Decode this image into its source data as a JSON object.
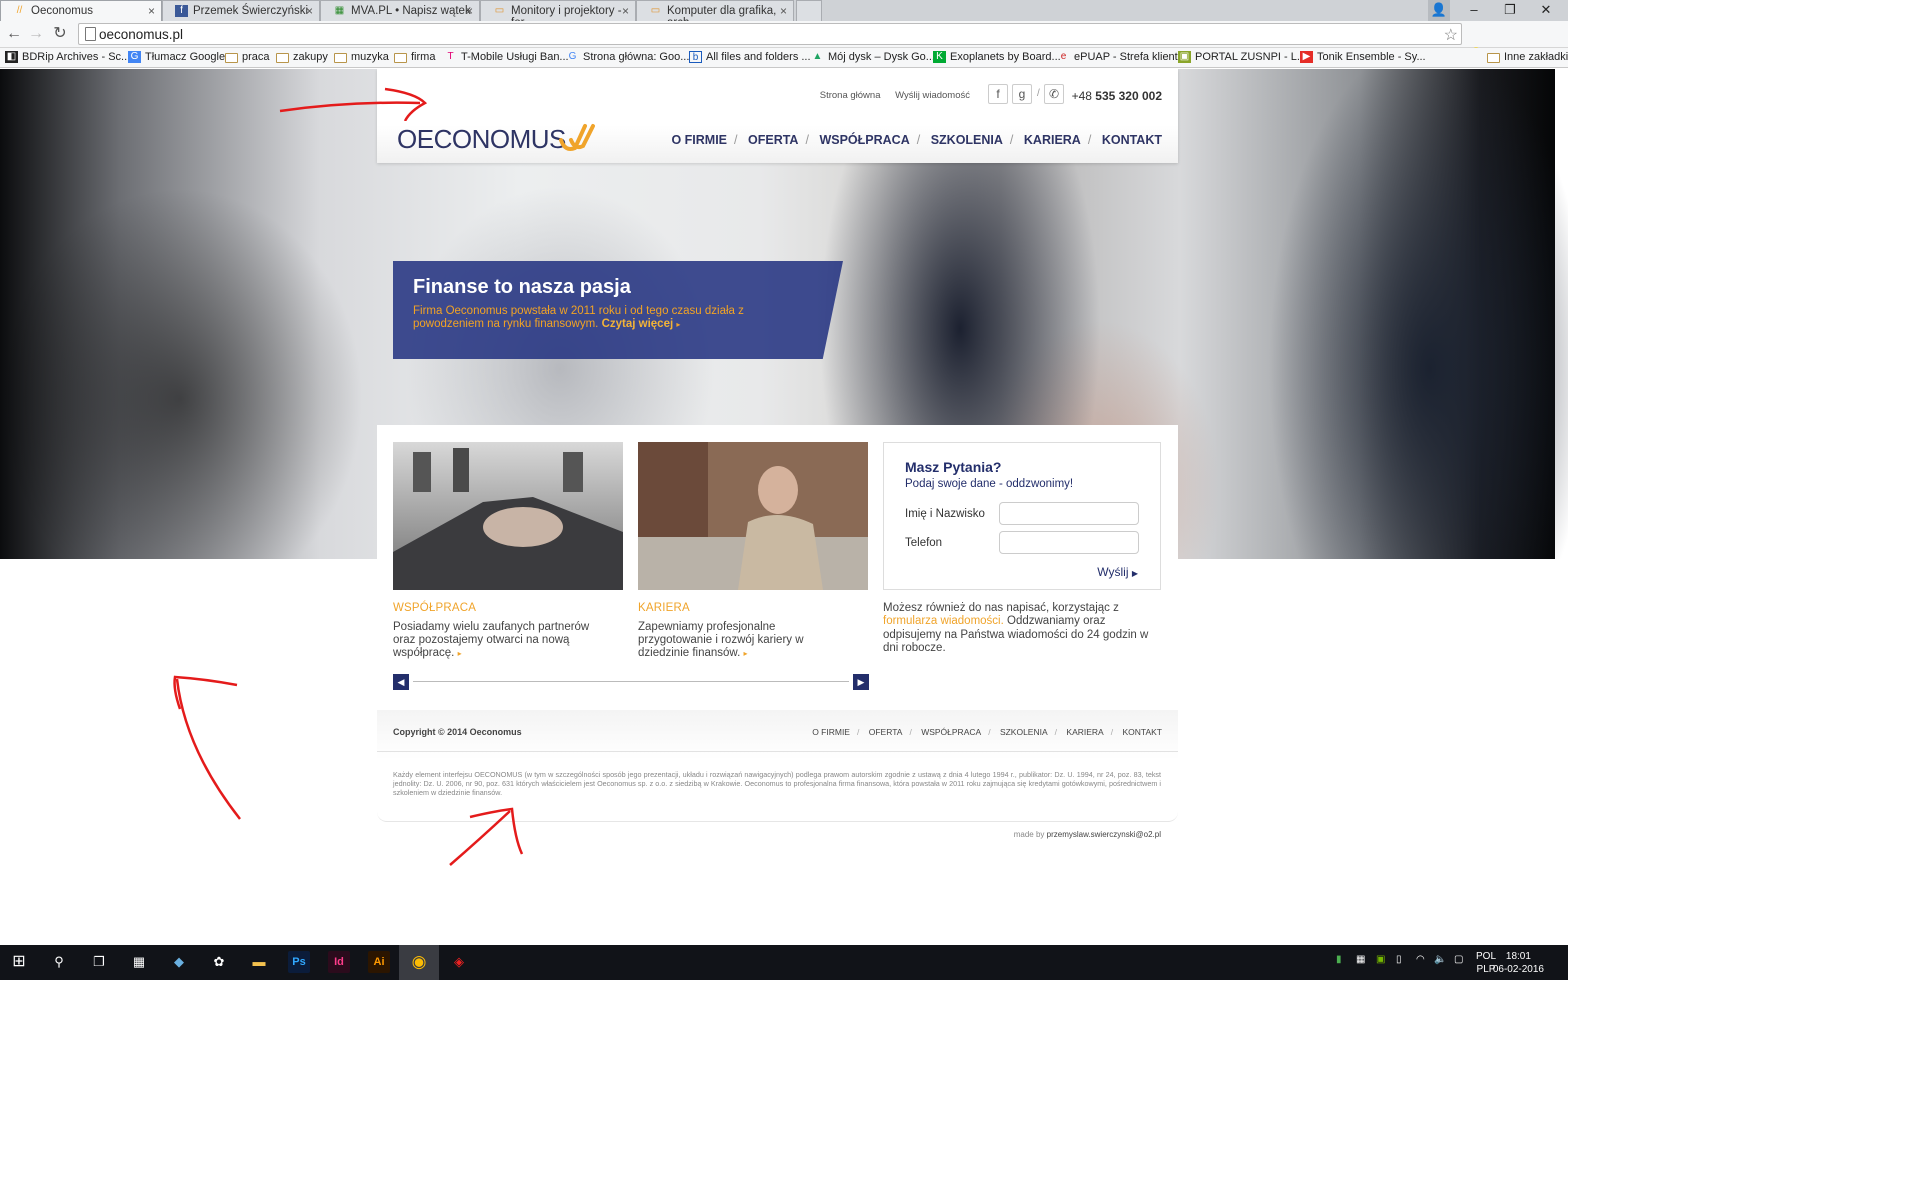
{
  "browser": {
    "tabs": [
      {
        "label": "Oeconomus",
        "active": true,
        "icon": "oeconomus-favicon"
      },
      {
        "label": "Przemek Świerczyński",
        "icon": "facebook-icon"
      },
      {
        "label": "MVA.PL • Napisz wątek",
        "icon": "mva-icon"
      },
      {
        "label": "Monitory i projektory - for",
        "icon": "folder-icon"
      },
      {
        "label": "Komputer dla grafika, arch",
        "icon": "folder-icon"
      }
    ],
    "url": "oeconomus.pl",
    "bookmarks": [
      {
        "label": "BDRip Archives - Sc...",
        "icon": "bdrip-icon"
      },
      {
        "label": "Tłumacz Google",
        "icon": "translate-icon"
      },
      {
        "label": "praca",
        "icon": "folder-icon"
      },
      {
        "label": "zakupy",
        "icon": "folder-icon"
      },
      {
        "label": "muzyka",
        "icon": "folder-icon"
      },
      {
        "label": "firma",
        "icon": "folder-icon"
      },
      {
        "label": "T-Mobile Usługi Ban...",
        "icon": "tmobile-icon"
      },
      {
        "label": "Strona główna: Goo...",
        "icon": "google-icon"
      },
      {
        "label": "All files and folders ...",
        "icon": "box-icon"
      },
      {
        "label": "Mój dysk – Dysk Go...",
        "icon": "drive-icon"
      },
      {
        "label": "Exoplanets by Board...",
        "icon": "kaggle-icon"
      },
      {
        "label": "ePUAP - Strefa klienta",
        "icon": "epuap-icon"
      },
      {
        "label": "PORTAL ZUSNPI - L...",
        "icon": "zus-icon"
      },
      {
        "label": "Tonik Ensemble - Sy...",
        "icon": "youtube-icon"
      },
      {
        "label": "Inne zakładki",
        "icon": "folder-icon"
      }
    ]
  },
  "site": {
    "top_links": [
      "Strona główna",
      "Wyślij wiadomość"
    ],
    "phone_prefix": "+48",
    "phone_number": "535 320 002",
    "logo_text": "OECONOMUS",
    "nav": [
      "O FIRMIE",
      "OFERTA",
      "WSPÓŁPRACA",
      "SZKOLENIA",
      "KARIERA",
      "KONTAKT"
    ],
    "hero": {
      "title": "Finanse to nasza pasja",
      "text": "Firma Oeconomus powstała w 2011 roku i od tego czasu działa z powodzeniem na rynku finansowym.",
      "link": "Czytaj więcej"
    },
    "cards": [
      {
        "title": "WSPÓŁPRACA",
        "text": "Posiadamy wielu zaufanych partnerów oraz pozostajemy otwarci na nową współpracę."
      },
      {
        "title": "KARIERA",
        "text": "Zapewniamy profesjonalne przygotowanie i rozwój kariery w dziedzinie finansów."
      }
    ],
    "form": {
      "title": "Masz Pytania?",
      "subtitle": "Podaj swoje dane - oddzwonimy!",
      "name_label": "Imię i Nazwisko",
      "phone_label": "Telefon",
      "submit": "Wyślij"
    },
    "contact": {
      "text1": "Możesz również do nas napisać, korzystając z",
      "link": "formularza wiadomości",
      "text2": "Oddzwaniamy oraz odpisujemy na Państwa wiadomości do 24 godzin w dni robocze."
    },
    "footer": {
      "copyright": "Copyright © 2014 Oeconomus",
      "nav": [
        "O FIRMIE",
        "OFERTA",
        "WSPÓŁPRACA",
        "SZKOLENIA",
        "KARIERA",
        "KONTAKT"
      ],
      "legal": "Każdy element interfejsu OECONOMUS (w tym w szczególności sposób jego prezentacji, układu i rozwiązań nawigacyjnych) podlega prawom autorskim zgodnie z ustawą z dnia 4 lutego 1994 r., publikator: Dz. U. 1994, nr 24, poz. 83, tekst jednolity: Dz. U. 2006, nr 90, poz. 631 których właścicielem jest Oeconomus sp. z o.o. z siedzibą w Krakowie. Oeconomus to profesjonalna firma finansowa, która powstała w 2011 roku zajmująca się kredytami gotówkowymi, pośrednictwem i szkoleniem w dziedzinie finansów.",
      "made_by_label": "made by",
      "made_by_email": "przemyslaw.swierczynski@o2.pl"
    }
  },
  "taskbar": {
    "language": "POL",
    "layout": "PLP",
    "time": "18:01",
    "date": "06-02-2016"
  },
  "colors": {
    "brand_navy": "#2e3464",
    "brand_orange": "#f0a42b",
    "banner_blue": "#263482"
  }
}
